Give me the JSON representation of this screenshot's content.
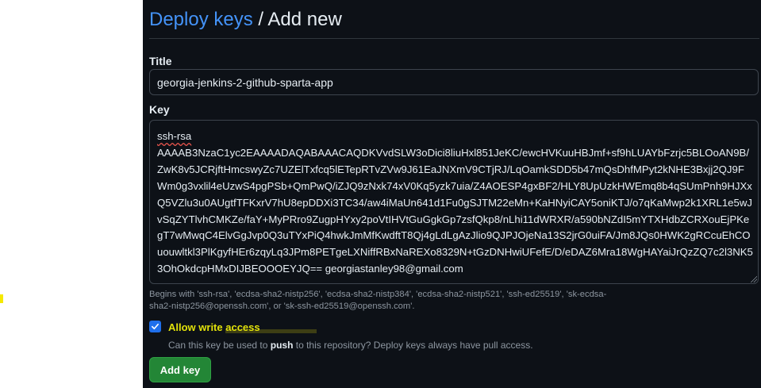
{
  "header": {
    "breadcrumb_link": "Deploy keys",
    "separator": "/",
    "current": "Add new"
  },
  "form": {
    "title_label": "Title",
    "title_value": "georgia-jenkins-2-github-sparta-app",
    "key_label": "Key",
    "key_type": "ssh-rsa",
    "key_body": "AAAAB3NzaC1yc2EAAAADAQABAAACAQDKVvdSLW3oDici8liuHxl851JeKC/ewcHVKuuHBJmf+sf9hLUAYbFzrjc5BLOoAN9B/ZwK8v5JCRjftHmcswyZc7UZElTxfcq5lETepRTvZVw9J61EaJNXmV9CTjRJ/LqOamkSDD5b47mQsDhfMPyt2kNHE3Bxjj2QJ9FWm0g3vxlil4eUzwS4pgPSb+QmPwQ/iZJQ9zNxk74xV0Kq5yzk7uia/Z4AOESP4gxBF2/HLY8UpUzkHWEmq8b4qSUmPnh9HJXxQ5VZlu3u0AUgtfTFKxrV7hU8epDDXi3TC34/aw4iMaUn641d1Fu0gSJTM22eMn+KaHNyiCAY5oniKTJ/o7qKaMwp2k1XRL1e5wJvSqZYTlvhCMKZe/faY+MyPRro9ZugpHYxy2poVtIHVtGuGgkGp7zsfQkp8/nLhi11dWRXR/a590bNZdI5mYTXHdbZCRXouEjPKegT7wMwqC4ElvGgJvp0Q3uTYxPiQ4hwkJmMfKwdftT8Qj4gLdLgAzJlio9QJPJOjeNa13S2jrG0uiFA/Jm8JQs0HWK2gRCcuEhCOuouwltkl3PlKgyfHEr6zqyLq3JPm8PETgeLXNiffRBxNaREXo8329N+tGzDNHwiUFefE/D/eDAZ6Mra18WgHAYaiJrQzZQ7c2l3NK53OhOkdcpHMxDIJBEOOOEYJQ== georgiastanley98@gmail.com",
    "hint_text": "Begins with 'ssh-rsa', 'ecdsa-sha2-nistp256', 'ecdsa-sha2-nistp384', 'ecdsa-sha2-nistp521', 'ssh-ed25519', 'sk-ecdsa-sha2-nistp256@openssh.com', or 'sk-ssh-ed25519@openssh.com'.",
    "allow_write_label": "Allow write access",
    "allow_write_checked": true,
    "allow_write_desc_prefix": "Can this key be used to ",
    "allow_write_desc_bold": "push",
    "allow_write_desc_suffix": " to this repository? Deploy keys always have pull access.",
    "submit_label": "Add key"
  },
  "colors": {
    "background": "#0d1117",
    "link": "#4493f8",
    "primary_button": "#238636",
    "checkbox": "#1f6feb",
    "highlight_text": "#e2e20a"
  }
}
